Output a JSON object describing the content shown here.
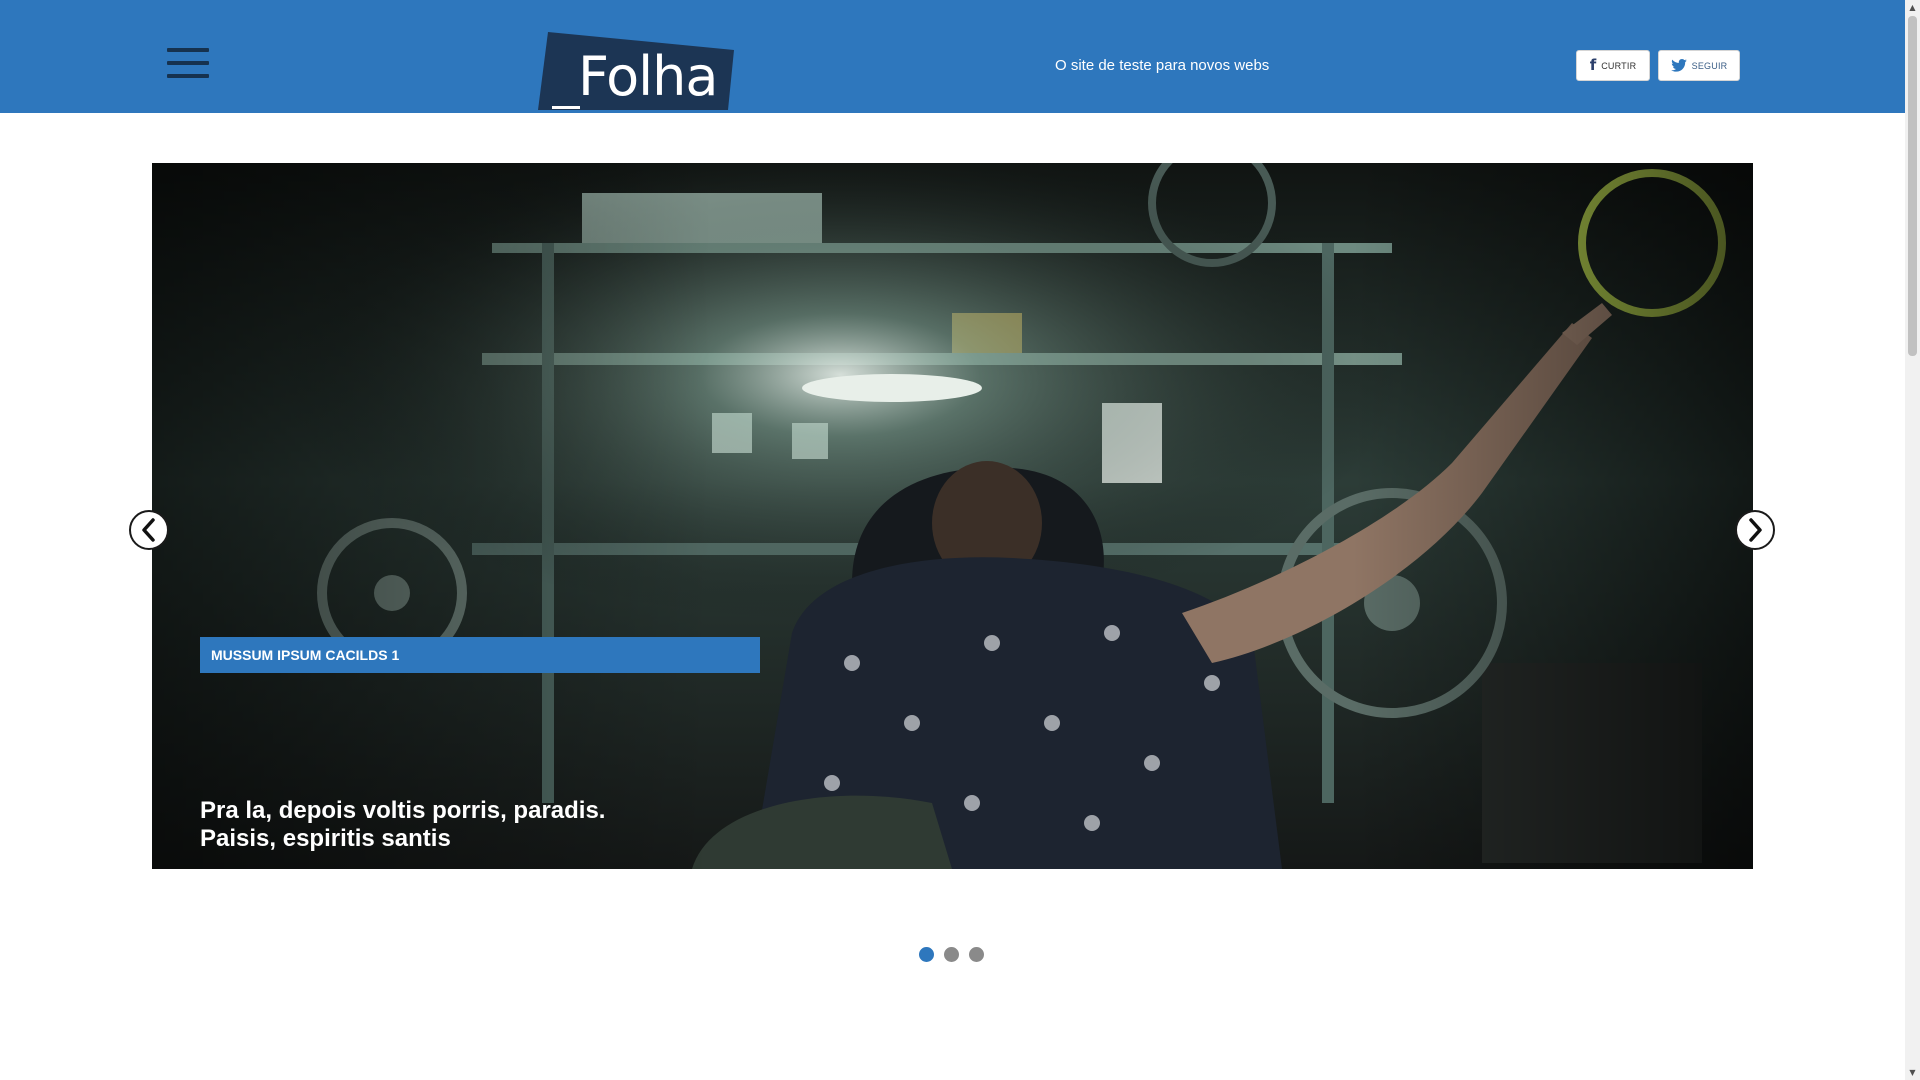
{
  "header": {
    "logo_text": "Folha",
    "tagline": "O site de teste para novos webs",
    "menu_icon": "hamburger-icon",
    "social": {
      "like_label": "CURTIR",
      "like_icon": "facebook-icon",
      "follow_label": "SEGUIR",
      "follow_icon": "twitter-icon"
    }
  },
  "slider": {
    "active_index": 0,
    "slide_count": 3,
    "current_slide": {
      "tag": "MUSSUM IPSUM CACILDS 1",
      "title_line1": "Pra la, depois voltis porris, paradis.",
      "title_line2": "Paisis, espiritis santis"
    },
    "prev_icon": "chevron-left-icon",
    "next_icon": "chevron-right-icon"
  },
  "colors": {
    "brand_blue": "#2e77bd",
    "logo_dark": "#1c3554",
    "dot_inactive": "#8a8a8a"
  }
}
